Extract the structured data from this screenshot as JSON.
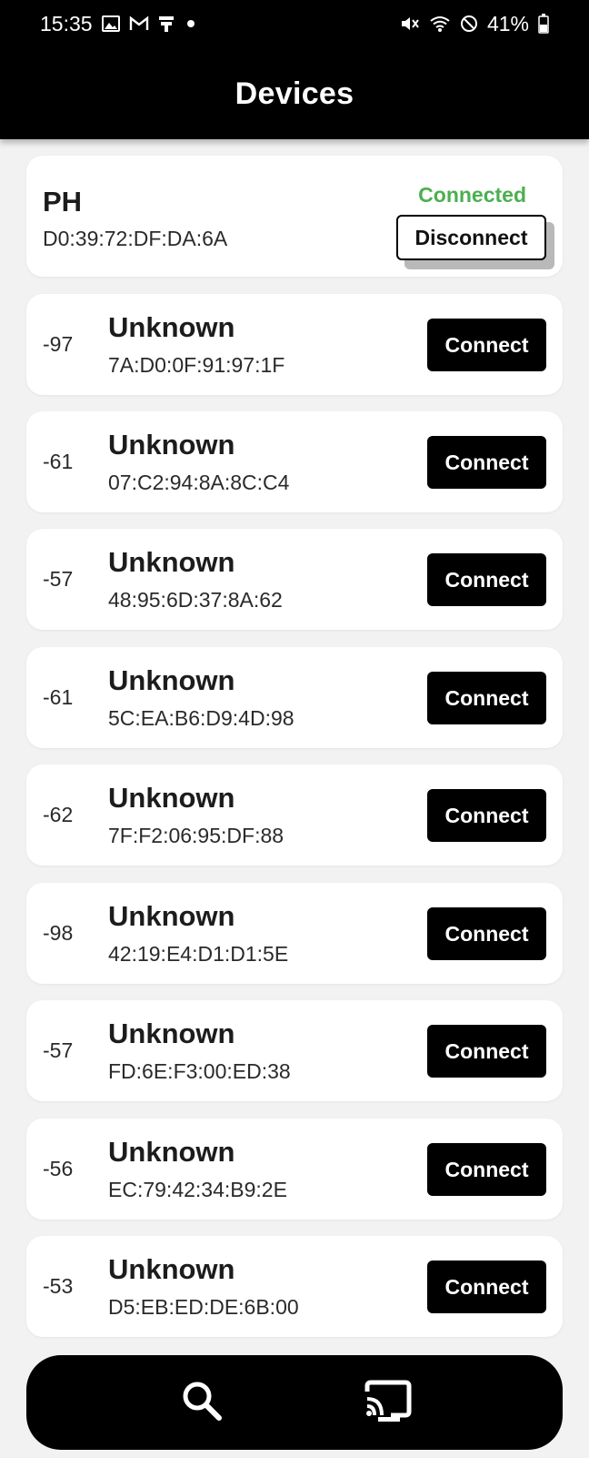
{
  "status_bar": {
    "time": "15:35",
    "left_icons": [
      "image-icon",
      "gmail-icon",
      "notification-icon",
      "dot-icon"
    ],
    "battery_percent": "41%",
    "right_icons": [
      "mute-icon",
      "wifi-icon",
      "do-not-disturb-icon",
      "battery-icon"
    ]
  },
  "app_bar": {
    "title": "Devices"
  },
  "connected_device": {
    "name": "PH",
    "mac": "D0:39:72:DF:DA:6A",
    "status": "Connected",
    "action_label": "Disconnect"
  },
  "devices": [
    {
      "rssi": "-97",
      "name": "Unknown",
      "mac": "7A:D0:0F:91:97:1F",
      "action_label": "Connect"
    },
    {
      "rssi": "-61",
      "name": "Unknown",
      "mac": "07:C2:94:8A:8C:C4",
      "action_label": "Connect"
    },
    {
      "rssi": "-57",
      "name": "Unknown",
      "mac": "48:95:6D:37:8A:62",
      "action_label": "Connect"
    },
    {
      "rssi": "-61",
      "name": "Unknown",
      "mac": "5C:EA:B6:D9:4D:98",
      "action_label": "Connect"
    },
    {
      "rssi": "-62",
      "name": "Unknown",
      "mac": "7F:F2:06:95:DF:88",
      "action_label": "Connect"
    },
    {
      "rssi": "-98",
      "name": "Unknown",
      "mac": "42:19:E4:D1:D1:5E",
      "action_label": "Connect"
    },
    {
      "rssi": "-57",
      "name": "Unknown",
      "mac": "FD:6E:F3:00:ED:38",
      "action_label": "Connect"
    },
    {
      "rssi": "-56",
      "name": "Unknown",
      "mac": "EC:79:42:34:B9:2E",
      "action_label": "Connect"
    },
    {
      "rssi": "-53",
      "name": "Unknown",
      "mac": "D5:EB:ED:DE:6B:00",
      "action_label": "Connect"
    }
  ],
  "bottom_nav": {
    "items": [
      {
        "icon": "search-icon"
      },
      {
        "icon": "cast-icon"
      }
    ]
  },
  "colors": {
    "status_bar_bg": "#000000",
    "app_bar_bg": "#000000",
    "page_bg": "#f2f2f2",
    "card_bg": "#ffffff",
    "connected_green": "#4caf50",
    "button_black": "#000000"
  }
}
